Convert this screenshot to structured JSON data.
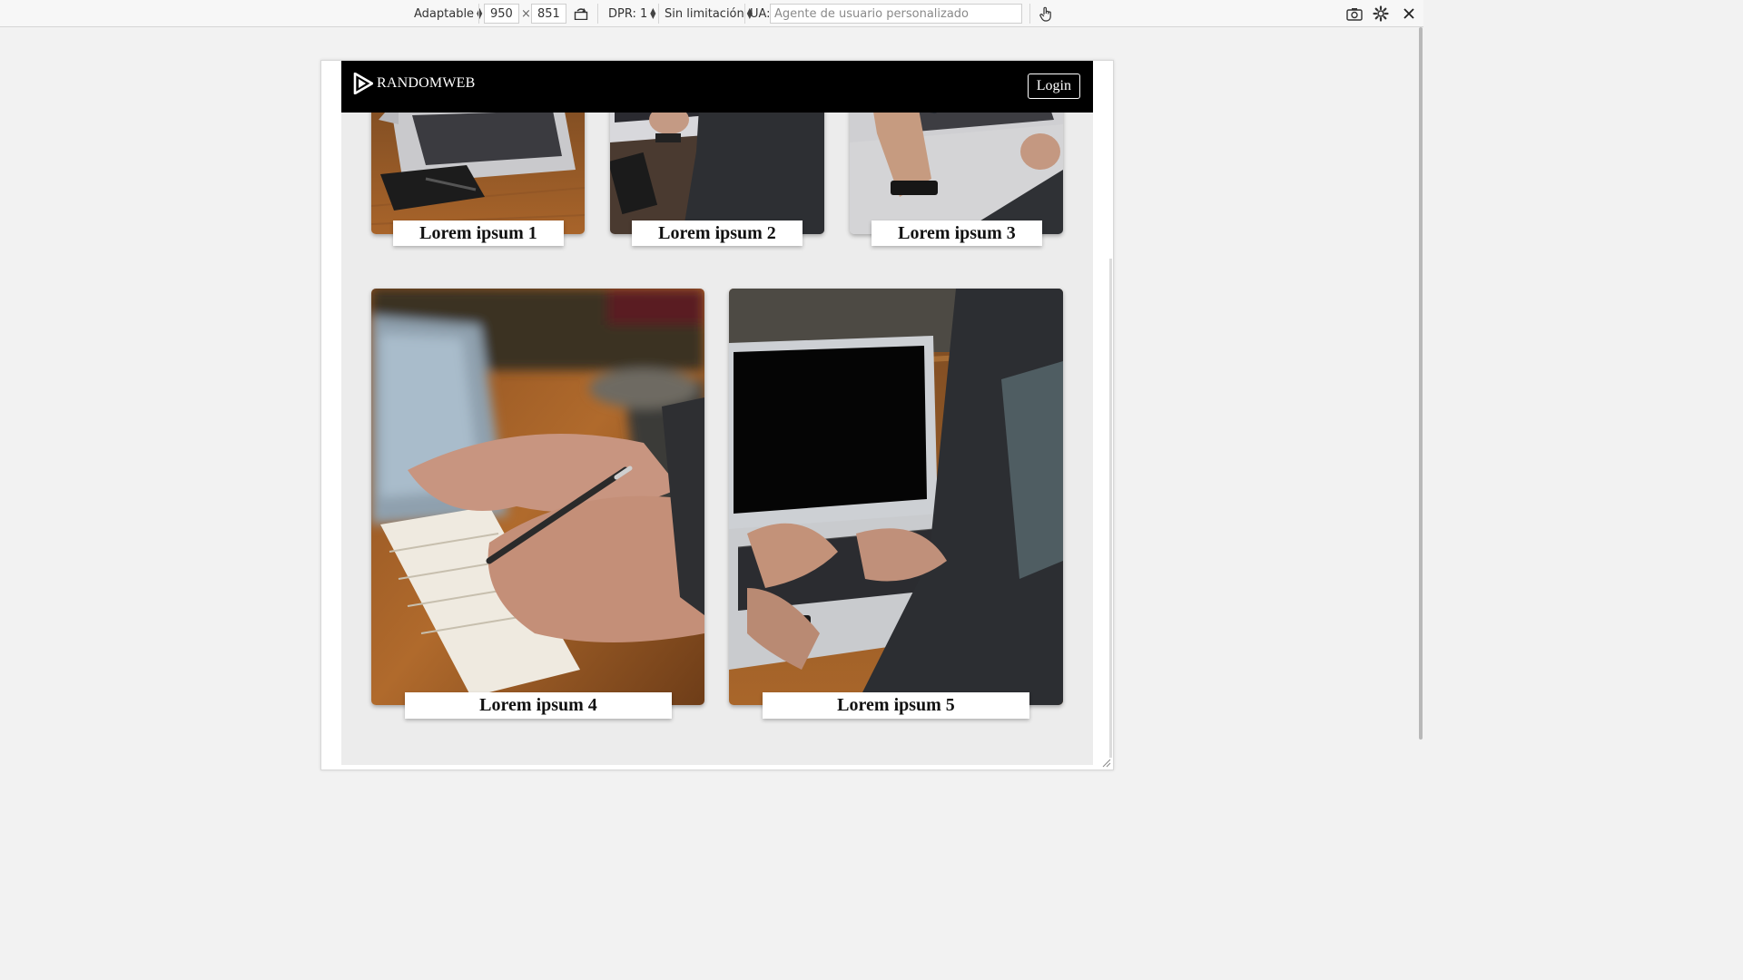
{
  "toolbar": {
    "device_mode": "Adaptable",
    "width": "950",
    "times": "×",
    "height": "851",
    "dpr": "DPR: 1",
    "throttle": "Sin limitación",
    "ua_label": "UA:",
    "ua_placeholder": "Agente de usuario personalizado"
  },
  "site": {
    "brand": "RANDOMWEB",
    "login_label": "Login"
  },
  "cards": [
    {
      "caption": "Lorem ipsum 1"
    },
    {
      "caption": "Lorem ipsum 2"
    },
    {
      "caption": "Lorem ipsum 3"
    },
    {
      "caption": "Lorem ipsum 4"
    },
    {
      "caption": "Lorem ipsum 5"
    }
  ],
  "colors": {
    "nav_bg": "#000000",
    "viewport_bg": "#ececec",
    "toolbar_bg": "#f7f7f7"
  }
}
